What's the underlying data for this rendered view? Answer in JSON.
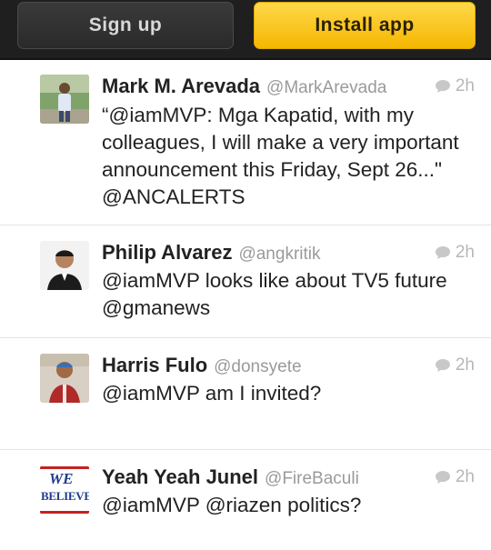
{
  "header": {
    "signup_label": "Sign up",
    "install_label": "Install app"
  },
  "tweets": [
    {
      "name": "Mark M. Arevada",
      "handle": "@MarkArevada",
      "time": "2h",
      "text": "“@iamMVP: Mga Kapatid, with my colleagues, I will make a very important announcement this Friday, Sept 26...\" @ANCALERTS"
    },
    {
      "name": "Philip Alvarez",
      "handle": "@angkritik",
      "time": "2h",
      "text": "@iamMVP looks like about TV5 future @gmanews"
    },
    {
      "name": "Harris Fulo",
      "handle": "@donsyete",
      "time": "2h",
      "text": "@iamMVP am I invited?"
    },
    {
      "name": "Yeah Yeah Junel",
      "handle": "@FireBaculi",
      "time": "2h",
      "text": "@iamMVP @riazen politics?",
      "avatar_text_top": "WE",
      "avatar_text_bottom": "BELIEVE"
    }
  ],
  "colors": {
    "install_button": "#f5b700",
    "topbar": "#1f1f1f",
    "handle": "#9a9a9a",
    "time": "#b7b7b7"
  }
}
